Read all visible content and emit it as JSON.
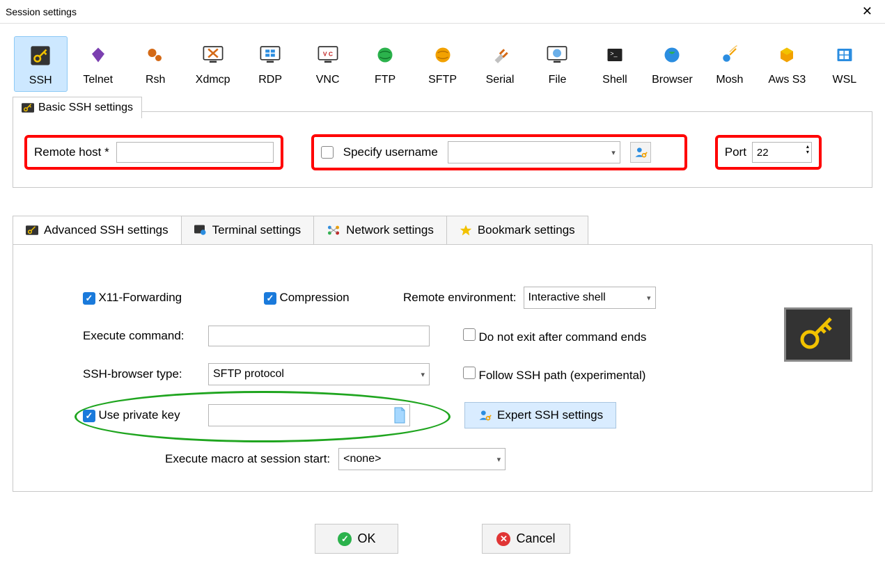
{
  "window": {
    "title": "Session settings"
  },
  "session_types": [
    {
      "id": "ssh",
      "label": "SSH",
      "selected": true
    },
    {
      "id": "telnet",
      "label": "Telnet"
    },
    {
      "id": "rsh",
      "label": "Rsh"
    },
    {
      "id": "xdmcp",
      "label": "Xdmcp"
    },
    {
      "id": "rdp",
      "label": "RDP"
    },
    {
      "id": "vnc",
      "label": "VNC"
    },
    {
      "id": "ftp",
      "label": "FTP"
    },
    {
      "id": "sftp",
      "label": "SFTP"
    },
    {
      "id": "serial",
      "label": "Serial"
    },
    {
      "id": "file",
      "label": "File"
    },
    {
      "id": "shell",
      "label": "Shell"
    },
    {
      "id": "browser",
      "label": "Browser"
    },
    {
      "id": "mosh",
      "label": "Mosh"
    },
    {
      "id": "awss3",
      "label": "Aws S3"
    },
    {
      "id": "wsl",
      "label": "WSL"
    }
  ],
  "basic": {
    "group_title": "Basic SSH settings",
    "remote_host_label": "Remote host *",
    "remote_host_value": "",
    "specify_username_label": "Specify username",
    "specify_username_checked": false,
    "username_value": "",
    "port_label": "Port",
    "port_value": "22"
  },
  "adv_tabs": {
    "advanced": "Advanced SSH settings",
    "terminal": "Terminal settings",
    "network": "Network settings",
    "bookmark": "Bookmark settings"
  },
  "advanced": {
    "x11_label": "X11-Forwarding",
    "x11_checked": true,
    "compression_label": "Compression",
    "compression_checked": true,
    "remote_env_label": "Remote environment:",
    "remote_env_value": "Interactive shell",
    "exec_cmd_label": "Execute command:",
    "exec_cmd_value": "",
    "no_exit_label": "Do not exit after command ends",
    "no_exit_checked": false,
    "browser_type_label": "SSH-browser type:",
    "browser_type_value": "SFTP protocol",
    "follow_path_label": "Follow SSH path (experimental)",
    "follow_path_checked": false,
    "use_pk_label": "Use private key",
    "use_pk_checked": true,
    "pk_value": "",
    "expert_label": "Expert SSH settings",
    "macro_label": "Execute macro at session start:",
    "macro_value": "<none>"
  },
  "buttons": {
    "ok": "OK",
    "cancel": "Cancel"
  }
}
